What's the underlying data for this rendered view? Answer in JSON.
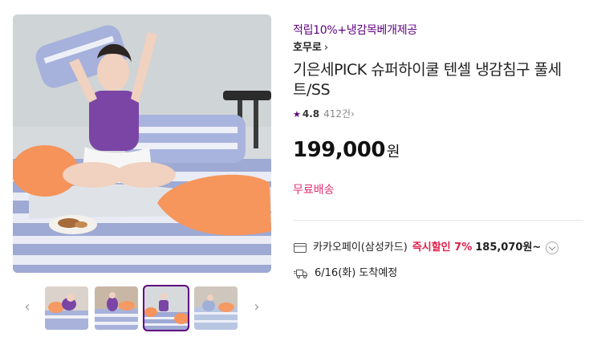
{
  "product": {
    "promo_text": "적립10%+냉감목베개제공",
    "brand": "호무로",
    "brand_chevron": "›",
    "title": "기은세PICK 슈퍼하이쿨 텐셀 냉감침구 풀세트/SS",
    "rating_star": "★",
    "rating_score": "4.8",
    "review_count": "412건",
    "review_chevron": "›",
    "price": "199,000",
    "currency_unit": "원",
    "shipping": "무료배송"
  },
  "payment": {
    "method": "카카오페이(삼성카드)",
    "discount": "즉시할인 7%",
    "discounted_price": "185,070원~"
  },
  "delivery": {
    "date_text": "6/16(화) 도착예정"
  },
  "gallery": {
    "prev_arrow": "‹",
    "next_arrow": "›",
    "thumbnails": [
      "thumbnail-1",
      "thumbnail-2",
      "thumbnail-3",
      "thumbnail-4"
    ],
    "selected_index": 3
  },
  "colors": {
    "accent_purple": "#5f0080",
    "shipping_pink": "#e02f71",
    "discount_red": "#e0204a"
  }
}
